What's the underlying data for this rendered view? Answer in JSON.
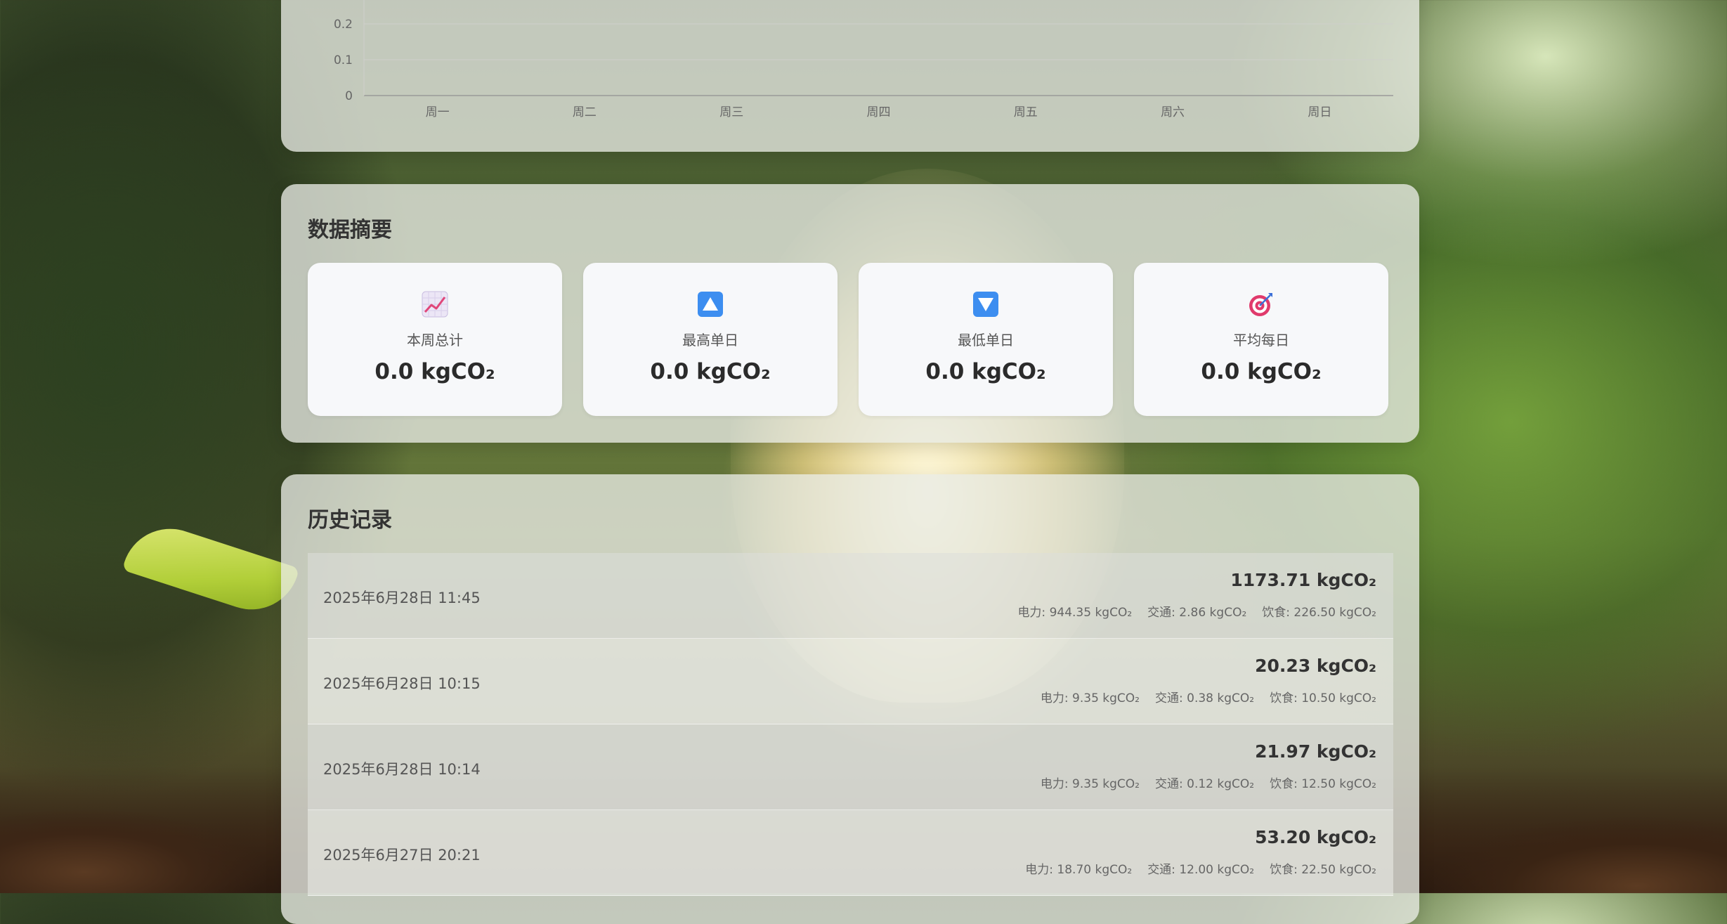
{
  "weekly_chart": {
    "chart_data": {
      "type": "bar",
      "categories": [
        "周一",
        "周二",
        "周三",
        "周四",
        "周五",
        "周六",
        "周日"
      ],
      "values": [
        0,
        0,
        0,
        0,
        0,
        0,
        0
      ],
      "y_ticks": [
        "0",
        "0.1",
        "0.2"
      ],
      "ylim": [
        0,
        0.2
      ],
      "grid": true
    }
  },
  "summary": {
    "title": "数据摘要",
    "cards": [
      {
        "icon": "chart-increasing-icon",
        "label": "本周总计",
        "value": "0.0 kgCO₂"
      },
      {
        "icon": "up-triangle-icon",
        "label": "最高单日",
        "value": "0.0 kgCO₂"
      },
      {
        "icon": "down-triangle-icon",
        "label": "最低单日",
        "value": "0.0 kgCO₂"
      },
      {
        "icon": "target-icon",
        "label": "平均每日",
        "value": "0.0 kgCO₂"
      }
    ]
  },
  "history": {
    "title": "历史记录",
    "records": [
      {
        "date": "2025年6月28日 11:45",
        "total": "1173.71 kgCO₂",
        "electricity": "电力: 944.35 kgCO₂",
        "transport": "交通: 2.86 kgCO₂",
        "food": "饮食: 226.50 kgCO₂"
      },
      {
        "date": "2025年6月28日 10:15",
        "total": "20.23 kgCO₂",
        "electricity": "电力: 9.35 kgCO₂",
        "transport": "交通: 0.38 kgCO₂",
        "food": "饮食: 10.50 kgCO₂"
      },
      {
        "date": "2025年6月28日 10:14",
        "total": "21.97 kgCO₂",
        "electricity": "电力: 9.35 kgCO₂",
        "transport": "交通: 0.12 kgCO₂",
        "food": "饮食: 12.50 kgCO₂"
      },
      {
        "date": "2025年6月27日 20:21",
        "total": "53.20 kgCO₂",
        "electricity": "电力: 18.70 kgCO₂",
        "transport": "交通: 12.00 kgCO₂",
        "food": "饮食: 22.50 kgCO₂"
      }
    ]
  }
}
